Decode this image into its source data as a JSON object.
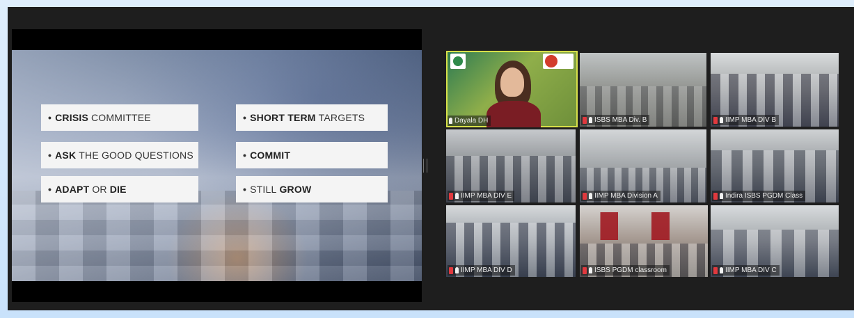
{
  "slide": {
    "bullets": [
      {
        "bold": "CRISIS",
        "rest": "COMMITTEE",
        "rest2": ""
      },
      {
        "bold": "SHORT TERM",
        "rest": "TARGETS",
        "rest2": ""
      },
      {
        "bold": "ASK",
        "rest": "THE GOOD QUESTIONS",
        "rest2": ""
      },
      {
        "bold": "COMMIT",
        "rest": "",
        "rest2": ""
      },
      {
        "bold": "ADAPT",
        "rest": "OR",
        "rest2": "DIE"
      },
      {
        "bold": "",
        "rest": "STILL",
        "rest2": "GROW"
      }
    ],
    "bullet_marker": "•"
  },
  "gallery": [
    {
      "name": "Dayala DH",
      "muted": false,
      "active": true
    },
    {
      "name": "ISBS MBA Div. B",
      "muted": true,
      "active": false
    },
    {
      "name": "IIMP MBA DIV B",
      "muted": true,
      "active": false
    },
    {
      "name": "IIMP MBA DIV E",
      "muted": true,
      "active": false
    },
    {
      "name": "IIMP MBA Division A",
      "muted": true,
      "active": false
    },
    {
      "name": "Indira ISBS PGDM Class",
      "muted": true,
      "active": false
    },
    {
      "name": "IIMP MBA DIV D",
      "muted": true,
      "active": false
    },
    {
      "name": "ISBS PGDM classroom",
      "muted": true,
      "active": false
    },
    {
      "name": "IIMP MBA DIV C",
      "muted": true,
      "active": false
    }
  ],
  "colors": {
    "active_speaker": "#d8e04a",
    "mic_muted": "#e0393e"
  }
}
